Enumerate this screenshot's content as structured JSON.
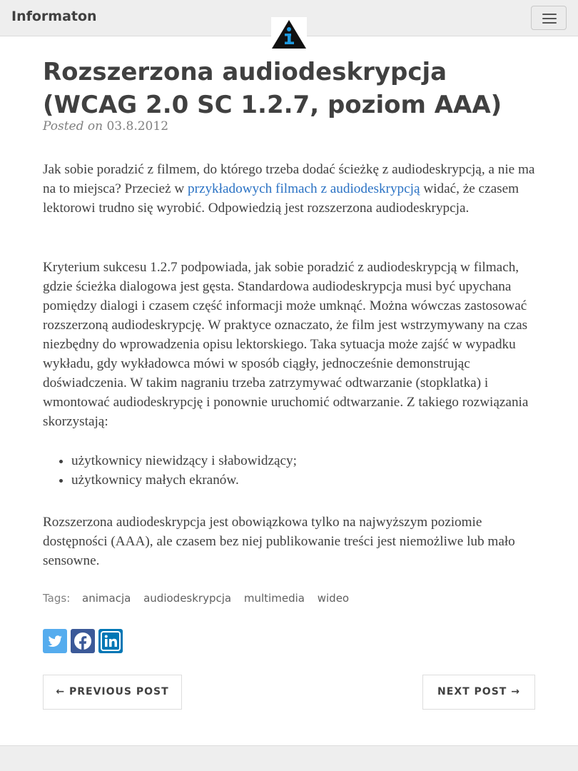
{
  "navbar": {
    "brand": "Informaton",
    "logo_icon": "info-triangle-logo-icon",
    "menu_icon": "hamburger-menu-icon"
  },
  "post": {
    "title": "Rozszerzona audiodeskrypcja (WCAG 2.0 SC 1.2.7, poziom AAA)",
    "meta_prefix": "Posted on",
    "date": "03.8.2012",
    "p1_before": "Jak sobie poradzić z filmem, do którego trzeba dodać ścieżkę z audiodeskrypcją, a nie ma na to miejsca? Przecież w ",
    "p1_link": "przykładowych filmach z audiodeskrypcją",
    "p1_after": " widać, że czasem lektorowi trudno się wyrobić. Odpowiedzią jest rozszerzona audiodeskrypcja.",
    "p2": "Kryterium sukcesu 1.2.7 podpowiada, jak sobie poradzić z audiodeskrypcją w filmach, gdzie ścieżka dialogowa jest gęsta. Standardowa audiodeskrypcja musi być upychana pomiędzy dialogi i czasem część informacji może umknąć. Można wówczas zastosować rozszerzoną audiodeskrypcję. W praktyce oznaczato, że film jest wstrzymywany na czas niezbędny do wprowadzenia opisu lektorskiego. Taka sytuacja może zajść w wypadku wykładu, gdy wykładowca mówi w sposób ciągły, jednocześnie demonstrując doświadczenia. W takim nagraniu trzeba zatrzymywać odtwarzanie (stopklatka) i wmontować audiodeskrypcję i ponownie uruchomić odtwarzanie. Z takiego rozwiązania skorzystają:",
    "bullets": [
      "użytkownicy niewidzący i słabowidzący;",
      "użytkownicy małych ekranów."
    ],
    "p3": "Rozszerzona audiodeskrypcja jest obowiązkowa tylko na najwyższym poziomie dostępności (AAA), ale czasem bez niej publikowanie treści jest niemożliwe lub mało sensowne."
  },
  "tags": {
    "label": "Tags:",
    "items": [
      "animacja",
      "audiodeskrypcja",
      "multimedia",
      "wideo"
    ]
  },
  "share": {
    "icons": [
      "twitter-icon",
      "facebook-icon",
      "linkedin-icon"
    ]
  },
  "pager": {
    "previous": "← PREVIOUS POST",
    "next": "NEXT POST →"
  },
  "colors": {
    "navbar_bg": "#eeeeee",
    "text": "#404040",
    "link": "#2a72c4",
    "twitter": "#55acee",
    "facebook": "#3b5998",
    "linkedin": "#0077b5",
    "logo_blue": "#1f9ae0"
  }
}
